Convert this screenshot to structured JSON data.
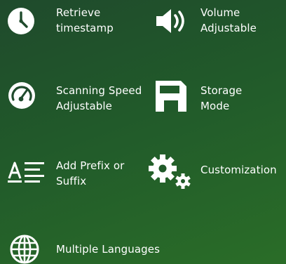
{
  "features": [
    {
      "id": "retrieve-timestamp",
      "icon": "clock-icon",
      "lines": [
        "Retrieve",
        "timestamp"
      ]
    },
    {
      "id": "volume-adjustable",
      "icon": "speaker-volume-icon",
      "lines": [
        "Volume",
        "Adjustable"
      ]
    },
    {
      "id": "scanning-speed",
      "icon": "speed-gauge-icon",
      "lines": [
        "Scanning Speed",
        "Adjustable"
      ]
    },
    {
      "id": "storage-mode",
      "icon": "floppy-disk-icon",
      "lines": [
        "Storage",
        "Mode"
      ]
    },
    {
      "id": "prefix-suffix",
      "icon": "text-format-icon",
      "lines": [
        "Add Prefix or",
        "Suffix"
      ]
    },
    {
      "id": "customization",
      "icon": "gears-icon",
      "lines": [
        "Customization"
      ]
    },
    {
      "id": "multiple-languages",
      "icon": "globe-icon",
      "lines": [
        "Multiple Languages"
      ]
    }
  ],
  "colors": {
    "background_start": "#1f4a2c",
    "background_end": "#2a6d28",
    "foreground": "#ffffff"
  }
}
